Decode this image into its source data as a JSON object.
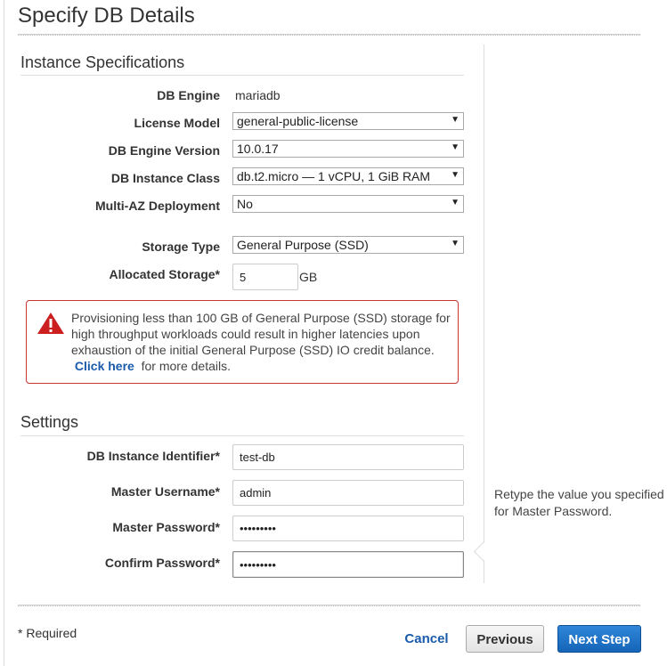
{
  "page": {
    "title": "Specify DB Details"
  },
  "instance_specs": {
    "title": "Instance Specifications",
    "db_engine": {
      "label": "DB Engine",
      "value": "mariadb"
    },
    "license_model": {
      "label": "License Model",
      "value": "general-public-license"
    },
    "engine_version": {
      "label": "DB Engine Version",
      "value": "10.0.17"
    },
    "instance_class": {
      "label": "DB Instance Class",
      "value": "db.t2.micro — 1 vCPU, 1 GiB RAM"
    },
    "multi_az": {
      "label": "Multi-AZ Deployment",
      "value": "No"
    },
    "storage_type": {
      "label": "Storage Type",
      "value": "General Purpose (SSD)"
    },
    "allocated_storage": {
      "label": "Allocated Storage*",
      "value": "5",
      "unit": "GB"
    }
  },
  "alert": {
    "icon": "warning-triangle-icon",
    "text": "Provisioning less than 100 GB of General Purpose (SSD) storage for high throughput workloads could result in higher latencies upon exhaustion of the initial General Purpose (SSD) IO credit balance.",
    "link_text": "Click here",
    "link_suffix": "for more details."
  },
  "settings": {
    "title": "Settings",
    "instance_identifier": {
      "label": "DB Instance Identifier*",
      "value": "test-db"
    },
    "master_username": {
      "label": "Master Username*",
      "value": "admin"
    },
    "master_password": {
      "label": "Master Password*",
      "value": "•••••••••"
    },
    "confirm_password": {
      "label": "Confirm Password*",
      "value": "•••••••••"
    }
  },
  "help": {
    "confirm_password": "Retype the value you specified for Master Password."
  },
  "footer": {
    "required_note": "* Required",
    "cancel_label": "Cancel",
    "previous_label": "Previous",
    "next_label": "Next Step"
  },
  "colors": {
    "primary": "#1a6fc4",
    "link": "#1a5bab",
    "alert_border": "#cc3333",
    "alert_icon": "#cc1f1f"
  }
}
